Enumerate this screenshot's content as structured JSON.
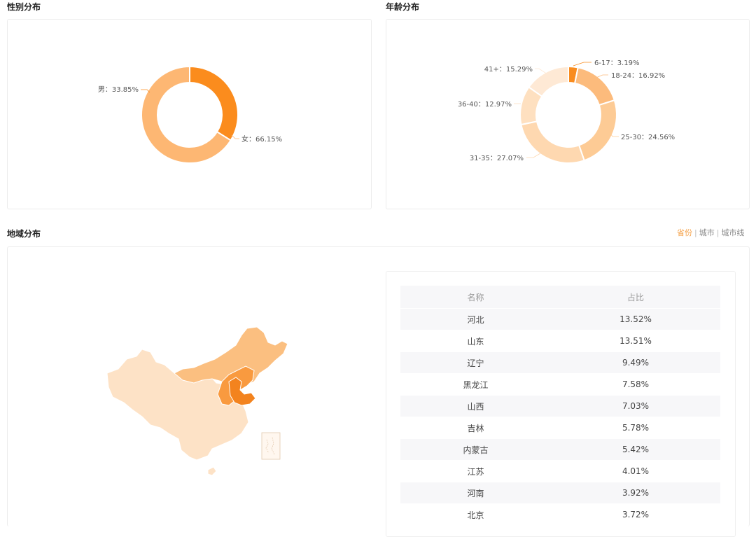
{
  "gender": {
    "title": "性别分布",
    "colors": [
      "#fb8c1d",
      "#fdb773"
    ],
    "chart_data": {
      "type": "pie",
      "categories": [
        "男",
        "女"
      ],
      "values": [
        33.85,
        66.15
      ],
      "labels": [
        "男：33.85%",
        "女：66.15%"
      ]
    }
  },
  "age": {
    "title": "年龄分布",
    "colors": [
      "#f98c1f",
      "#fcbb7c",
      "#fdcb95",
      "#fed8b0",
      "#fee0c0",
      "#fee9d5"
    ],
    "chart_data": {
      "type": "pie",
      "categories": [
        "6-17",
        "18-24",
        "25-30",
        "31-35",
        "36-40",
        "41+"
      ],
      "values": [
        3.19,
        16.92,
        24.56,
        27.07,
        12.97,
        15.29
      ],
      "labels": [
        "6-17：3.19%",
        "18-24：16.92%",
        "25-30：24.56%",
        "31-35：27.07%",
        "36-40：12.97%",
        "41+：15.29%"
      ]
    }
  },
  "region": {
    "title": "地域分布",
    "tabs": [
      "省份",
      "城市",
      "城市线"
    ],
    "table": {
      "headers": [
        "名称",
        "占比"
      ],
      "rows": [
        [
          "河北",
          "13.52%"
        ],
        [
          "山东",
          "13.51%"
        ],
        [
          "辽宁",
          "9.49%"
        ],
        [
          "黑龙江",
          "7.58%"
        ],
        [
          "山西",
          "7.03%"
        ],
        [
          "吉林",
          "5.78%"
        ],
        [
          "内蒙古",
          "5.42%"
        ],
        [
          "江苏",
          "4.01%"
        ],
        [
          "河南",
          "3.92%"
        ],
        [
          "北京",
          "3.72%"
        ]
      ]
    },
    "map_colors": {
      "light": "#fde2c6",
      "medium": "#fbbf80",
      "strong": "#f99a3f",
      "dark": "#f3831e"
    }
  }
}
